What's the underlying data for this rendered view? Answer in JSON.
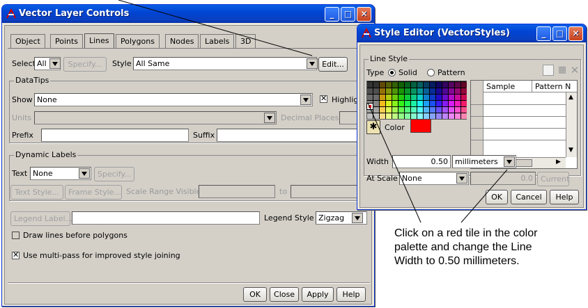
{
  "main_window": {
    "title": "Vector Layer Controls",
    "tabs": [
      "Object",
      "Points",
      "Lines",
      "Polygons",
      "Nodes",
      "Labels",
      "3D"
    ],
    "active_tab": "Lines",
    "select_label": "Select",
    "select_value": "All",
    "specify_label": "Specify...",
    "style_label": "Style",
    "style_value": "All Same",
    "edit_label": "Edit...",
    "datatips": {
      "group_label": "DataTips",
      "show_label": "Show",
      "show_value": "None",
      "highlight_label": "Highlight",
      "units_label": "Units",
      "decimal_places_label": "Decimal Places",
      "prefix_label": "Prefix",
      "suffix_label": "Suffix"
    },
    "dynamic_labels": {
      "group_label": "Dynamic Labels",
      "text_label": "Text",
      "text_value": "None",
      "specify_label": "Specify...",
      "text_style_label": "Text Style...",
      "frame_style_label": "Frame Style...",
      "scale_range_label": "Scale Range Visible",
      "to_label": "to"
    },
    "legend_label_button": "Legend Label...",
    "legend_style_label": "Legend Style",
    "legend_style_value": "Zigzag",
    "draw_lines_label": "Draw lines before polygons",
    "multipass_label": "Use multi-pass for improved style joining",
    "buttons": {
      "ok": "OK",
      "close": "Close",
      "apply": "Apply",
      "help": "Help"
    }
  },
  "style_editor": {
    "title": "Style Editor (VectorStyles)",
    "group_label": "Line Style",
    "type_label": "Type",
    "solid_label": "Solid",
    "pattern_label": "Pattern",
    "color_label": "Color",
    "color_value": "#ff0000",
    "columns": [
      "Sample",
      "Pattern N"
    ],
    "width_label": "Width",
    "width_value": "0.50",
    "width_units": "millimeters",
    "at_scale_label": "At Scale",
    "at_scale_value": "None",
    "scale_value": "0.0",
    "current_label": "Current",
    "buttons": {
      "ok": "OK",
      "cancel": "Cancel",
      "help": "Help"
    }
  },
  "annotation": {
    "lines": [
      "Click on a red tile in the color",
      "palette and change the Line",
      "Width to 0.50 millimeters."
    ]
  },
  "colors": {
    "titlebar": "#0045d4",
    "window_bg": "#d4d0c8",
    "selected_color": "#ff0000"
  }
}
